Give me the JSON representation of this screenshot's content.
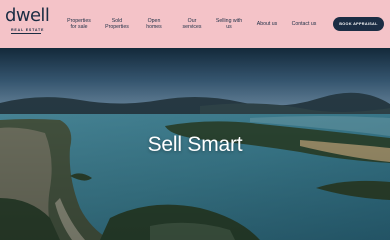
{
  "brand": {
    "name": "dwell",
    "tagline": "REAL ESTATE"
  },
  "nav": {
    "items": [
      {
        "line1": "Properties",
        "line2": "for sale"
      },
      {
        "line1": "Sold",
        "line2": "Properties"
      },
      {
        "line1": "Open",
        "line2": "homes"
      },
      {
        "line1": "Our",
        "line2": "services"
      },
      {
        "line1": "Selling with",
        "line2": "us"
      },
      {
        "line1": "About us",
        "line2": ""
      },
      {
        "line1": "Contact us",
        "line2": ""
      }
    ],
    "cta_label": "BOOK APPRAISAL"
  },
  "hero": {
    "title": "Sell Smart"
  },
  "colors": {
    "header_bg": "#f4c3c8",
    "brand_navy": "#1b2d44",
    "hero_text": "#ffffff"
  }
}
